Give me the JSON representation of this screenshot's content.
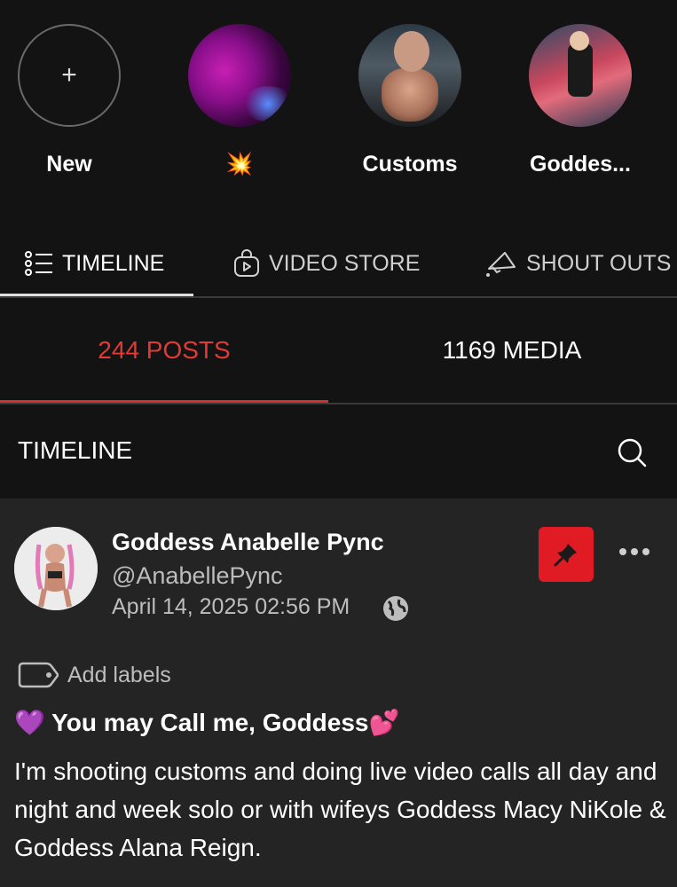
{
  "stories": [
    {
      "label": "New",
      "icon": "plus-icon"
    },
    {
      "label": "💥",
      "icon": "story-thumbnail"
    },
    {
      "label": "Customs",
      "icon": "story-thumbnail"
    },
    {
      "label": "Goddes...",
      "icon": "story-thumbnail"
    }
  ],
  "tabs": [
    {
      "label": "TIMELINE",
      "icon": "list-icon",
      "active": true
    },
    {
      "label": "VIDEO STORE",
      "icon": "video-bag-icon",
      "active": false
    },
    {
      "label": "SHOUT OUTS",
      "icon": "megaphone-icon",
      "active": false
    }
  ],
  "subtabs": {
    "posts": "244 POSTS",
    "media": "1169 MEDIA"
  },
  "timeline": {
    "title": "TIMELINE"
  },
  "post": {
    "author": "Goddess Anabelle Pync",
    "handle": "@AnabellePync",
    "date": "April 14, 2025 02:56 PM",
    "add_labels": "Add labels",
    "headline": "💜 You may Call me, Goddess💕",
    "body": "I'm shooting customs and doing live video calls all day and night and week solo or with wifeys Goddess Macy NiKole & Goddess Alana Reign."
  },
  "colors": {
    "accent": "#e01b24",
    "background": "#131313",
    "card": "#242424"
  }
}
